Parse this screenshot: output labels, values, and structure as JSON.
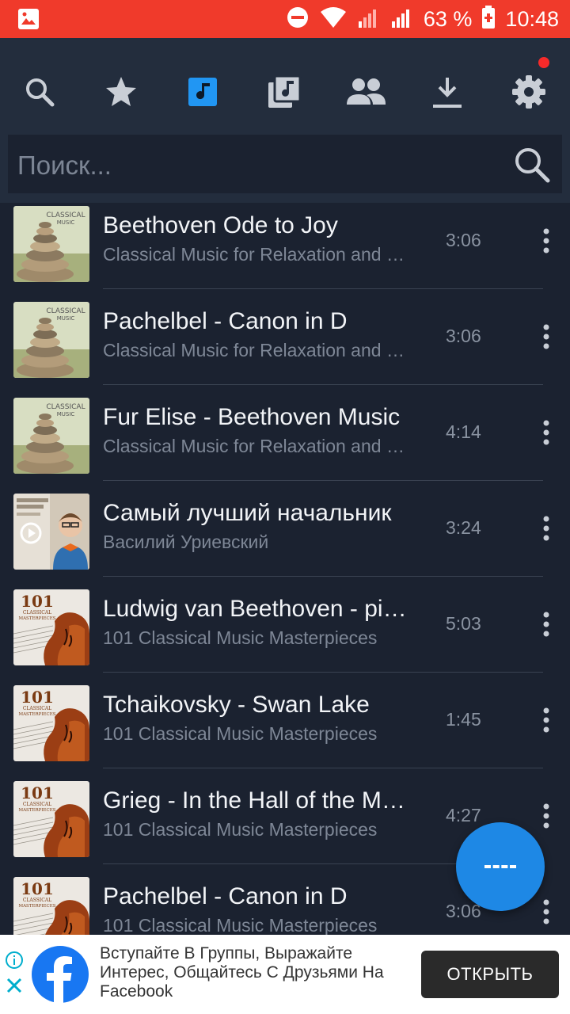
{
  "status_bar": {
    "battery": "63 %",
    "time": "10:48"
  },
  "toolbar": {
    "icons": [
      "search-icon",
      "star-icon",
      "music-note-icon",
      "playlist-icon",
      "people-icon",
      "download-icon",
      "settings-icon"
    ],
    "accent": "#2196f3"
  },
  "search": {
    "placeholder": "Поиск..."
  },
  "tracks": [
    {
      "title": "Beethoven Ode to Joy",
      "subtitle": "Classical Music for Relaxation and Studying",
      "duration": "3:06",
      "cover": "stones"
    },
    {
      "title": "Pachelbel - Canon in D",
      "subtitle": "Classical Music for Relaxation and Studying",
      "duration": "3:06",
      "cover": "stones"
    },
    {
      "title": "Fur Elise - Beethoven Music",
      "subtitle": "Classical Music for Relaxation and Studying",
      "duration": "4:14",
      "cover": "stones"
    },
    {
      "title": "Самый лучший начальник",
      "subtitle": "Василий Уриевский",
      "duration": "3:24",
      "cover": "portrait"
    },
    {
      "title": "Ludwig van Beethoven - piano",
      "subtitle": "101 Classical Music Masterpieces",
      "duration": "5:03",
      "cover": "violin"
    },
    {
      "title": "Tchaikovsky - Swan Lake",
      "subtitle": "101 Classical Music Masterpieces",
      "duration": "1:45",
      "cover": "violin"
    },
    {
      "title": "Grieg - In the Hall of the Mountain King",
      "subtitle": "101 Classical Music Masterpieces",
      "duration": "4:27",
      "cover": "violin"
    },
    {
      "title": "Pachelbel - Canon in D",
      "subtitle": "101 Classical Music Masterpieces",
      "duration": "3:06",
      "cover": "violin"
    }
  ],
  "ad": {
    "text": "Вступайте В Группы, Выражайте Интерес, Общайтесь С Друзьями На Facebook",
    "button": "ОТКРЫТЬ"
  },
  "colors": {
    "background": "#1b2230",
    "toolbar": "#232d3d",
    "status_bar": "#f03a2b",
    "fab": "#1e88e5"
  }
}
